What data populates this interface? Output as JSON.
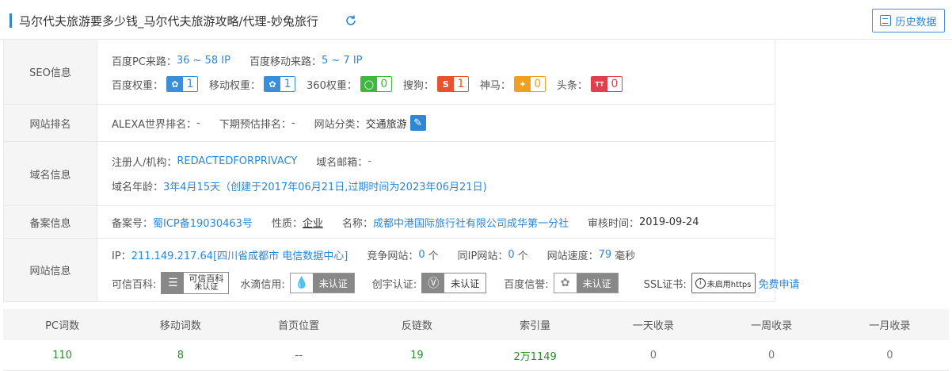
{
  "header": {
    "title": "马尔代夫旅游要多少钱_马尔代夫旅游攻略/代理-妙兔旅行",
    "history_button": "历史数据"
  },
  "seo": {
    "label": "SEO信息",
    "pc_source_label": "百度PC来路：",
    "pc_source_value": "36 ~ 58 IP",
    "mobile_source_label": "百度移动来路：",
    "mobile_source_value": "5 ~ 7 IP",
    "ranks": [
      {
        "label": "百度权重：",
        "value": "1",
        "icon": "paw-icon",
        "color": "#3b8fd9"
      },
      {
        "label": "移动权重：",
        "value": "1",
        "icon": "paw-icon",
        "color": "#3b8fd9"
      },
      {
        "label": "360权重：",
        "value": "0",
        "icon": "ring-icon",
        "color": "#3fb83f"
      },
      {
        "label": "搜狗：",
        "value": "1",
        "icon": "sogou-icon",
        "color": "#e8532d"
      },
      {
        "label": "神马：",
        "value": "0",
        "icon": "shenma-icon",
        "color": "#f0a020"
      },
      {
        "label": "头条：",
        "value": "0",
        "icon": "toutiao-icon",
        "color": "#e0404e"
      }
    ]
  },
  "rank": {
    "label": "网站排名",
    "alexa_label": "ALEXA世界排名：",
    "alexa_value": "-",
    "forecast_label": "下期预估排名：",
    "forecast_value": "-",
    "category_label": "网站分类：",
    "category_value": "交通旅游"
  },
  "domain": {
    "label": "域名信息",
    "registrant_label": "注册人/机构：",
    "registrant_value": "REDACTEDFORPRIVACY",
    "email_label": "域名邮箱：",
    "email_value": "-",
    "age_label": "域名年龄：",
    "age_value": "3年4月15天（创建于2017年06月21日,过期时间为2023年06月21日)"
  },
  "icp": {
    "label": "备案信息",
    "number_label": "备案号：",
    "number_value": "蜀ICP备19030463号",
    "nature_label": "性质：",
    "nature_value": "企业",
    "name_label": "名称：",
    "name_value": "成都中港国际旅行社有限公司成华第一分社",
    "review_label": "审核时间：",
    "review_value": "2019-09-24"
  },
  "site": {
    "label": "网站信息",
    "ip_label": "IP：",
    "ip_value": "211.149.217.64[四川省成都市 电信数据中心]",
    "compete_label": "竞争网站：",
    "compete_value": "0",
    "compete_unit": "个",
    "sameip_label": "同IP网站：",
    "sameip_value": "0",
    "sameip_unit": "个",
    "speed_label": "网站速度：",
    "speed_value": "79",
    "speed_unit": "毫秒",
    "certs": {
      "baike_label": "可信百科:",
      "baike_text1": "可信百科",
      "baike_text2": "未认证",
      "shuidi_label": "水滴信用:",
      "shuidi_text": "未认证",
      "chuangyu_label": "创宇认证:",
      "chuangyu_text": "未认证",
      "baidu_label": "百度信誉:",
      "baidu_text": "未认证",
      "ssl_label": "SSL证书:",
      "ssl_text": "未启用https",
      "ssl_apply": "免费申请"
    }
  },
  "stats": {
    "headers": [
      "PC词数",
      "移动词数",
      "首页位置",
      "反链数",
      "索引量",
      "一天收录",
      "一周收录",
      "一月收录"
    ],
    "values": [
      "110",
      "8",
      "--",
      "19",
      "2万1149",
      "0",
      "0",
      "0"
    ]
  },
  "colors": {
    "accent": "#2e86d4",
    "green": "#2e8b2e",
    "red": "#d9363e"
  }
}
